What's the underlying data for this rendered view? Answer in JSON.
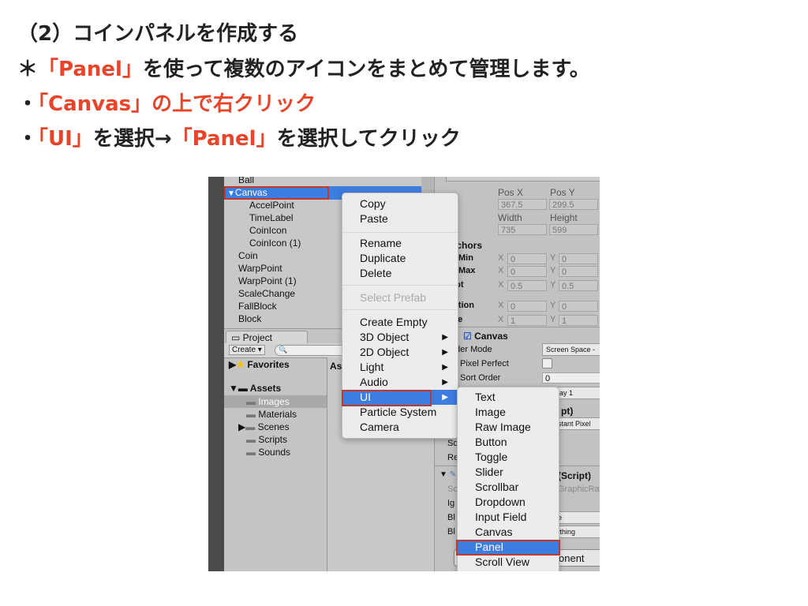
{
  "slide": {
    "line1": "（2）コインパネルを作成する",
    "line2_prefix": "＊",
    "line2_red": "「Panel」",
    "line2_rest": "を使って複数のアイコンをまとめて管理します。",
    "line3_bullet": "・",
    "line3_red": "「Canvas」の上で右クリック",
    "line4_bullet": "・",
    "line4_red1": "「UI」",
    "line4_mid": "を選択→",
    "line4_red2": "「Panel」",
    "line4_rest": "を選択してクリック",
    "accent_color": "#e8442a"
  },
  "hierarchy": {
    "items": [
      "Ball",
      "Canvas",
      "AccelPoint",
      "TimeLabel",
      "CoinIcon",
      "CoinIcon (1)",
      "Coin",
      "WarpPoint",
      "WarpPoint (1)",
      "ScaleChange",
      "FallBlock",
      "Block"
    ],
    "selected": "Canvas"
  },
  "project": {
    "tab": "Project",
    "create": "Create ▾",
    "favorites": "Favorites",
    "assets": "Assets",
    "assets_col": "As",
    "folders": [
      "Images",
      "Materials",
      "Scenes",
      "Scripts",
      "Sounds"
    ]
  },
  "inspector": {
    "posx_label": "Pos X",
    "posy_label": "Pos Y",
    "posx": "367.5",
    "posy": "299.5",
    "width_label": "Width",
    "height_label": "Height",
    "width": "735",
    "height": "599",
    "anchors": "nchors",
    "min": "Min",
    "max": "Max",
    "pivot": "vot",
    "rotation": "tation",
    "scale": "ale",
    "x": "X",
    "y": "Y",
    "min_x": "0",
    "min_y": "0",
    "max_x": "0",
    "max_y": "0",
    "pivot_x": "0.5",
    "pivot_y": "0.5",
    "rot_x": "0",
    "rot_y": "0",
    "scale_x": "1",
    "scale_y": "1",
    "canvas": "Canvas",
    "render_mode": "nder Mode",
    "render_mode_value": "Screen Space -",
    "pixel_perfect": "Pixel Perfect",
    "sort_order": "Sort Order",
    "sort_order_value": "0",
    "display": "play 1",
    "script1": "pt)",
    "scaler_mode": "nstant Pixel",
    "sc": "Sc",
    "re": "Re",
    "script2": "(Script)",
    "sc2": "Sc",
    "raycaster": "GraphicRay",
    "ig": "Ig",
    "bl1": "Bl",
    "bl1_val": "ne",
    "bl2": "Bl",
    "bl2_val": "rything",
    "add_component": "onent"
  },
  "context_menu": {
    "items": [
      "Copy",
      "Paste",
      "Rename",
      "Duplicate",
      "Delete",
      "Select Prefab",
      "Create Empty",
      "3D Object",
      "2D Object",
      "Light",
      "Audio",
      "UI",
      "Particle System",
      "Camera"
    ],
    "highlighted": "UI"
  },
  "ui_submenu": {
    "items": [
      "Text",
      "Image",
      "Raw Image",
      "Button",
      "Toggle",
      "Slider",
      "Scrollbar",
      "Dropdown",
      "Input Field",
      "Canvas",
      "Panel",
      "Scroll View"
    ],
    "highlighted": "Panel"
  }
}
